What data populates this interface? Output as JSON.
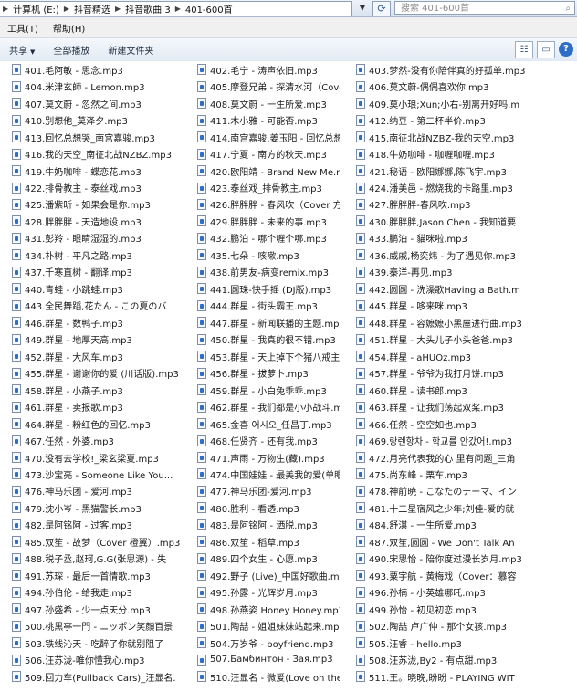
{
  "addressbar": {
    "crumbs": [
      "计算机 (E:)",
      "抖音精选",
      "抖音歌曲 3",
      "401-600首"
    ],
    "search_placeholder": "搜索 401-600首"
  },
  "menubar": {
    "items": [
      "工具(T)",
      "帮助(H)"
    ]
  },
  "commandbar": {
    "share_label": "共享",
    "play_all_label": "全部播放",
    "new_folder_label": "新建文件夹"
  },
  "files": [
    "401.毛阿敏 - 思念.mp3",
    "402.毛宁 - 涛声依旧.mp3",
    "403.梦然-没有你陪伴真的好孤单.mp3",
    "404.米津玄師 - Lemon.mp3",
    "405.摩登兄弟 - 探清水河（Cover：",
    "406.莫文蔚-偶偶喜欢你.mp3",
    "407.莫文蔚 - 忽然之间.mp3",
    "408.莫文蔚 - 一生所爱.mp3",
    "409.莫小琅;Xun;小右-别离开好吗.m",
    "410.别想他_莫泽夕.mp3",
    "411.木小雅 - 可能否.mp3",
    "412.纳豆 - 第二杯半价.mp3",
    "413.回忆总想哭_南宫嘉骏.mp3",
    "414.南宫嘉骏,姜玉阳 - 回忆总想哭",
    "415.南征北战NZBZ-我的天空.mp3",
    "416.我的天空_南征北战NZBZ.mp3",
    "417.宁夏 - 南方的秋天.mp3",
    "418.牛奶咖啡 - 咖喱咖喱.mp3",
    "419.牛奶咖啡 - 蝶恋花.mp3",
    "420.欧阳靖 - Brand New Me.mp3",
    "421.秘语 - 欧阳娜娜,陈飞宇.mp3",
    "422.排骨教主 - 泰丝戏.mp3",
    "423.泰丝戏_排骨教主.mp3",
    "424.潘美邑 - 燃烧我的卡路里.mp3",
    "425.潘紫昕 - 如果会是你.mp3",
    "426.胖胖胖 - 春风吹（Cover 方大",
    "427.胖胖胖-春风吹.mp3",
    "428.胖胖胖 - 天造地设.mp3",
    "429.胖胖胖 - 未来的事.mp3",
    "430.胖胖胖,Jason Chen - 我知道要",
    "431.彭羚 - 眼睛湿湿的.mp3",
    "432.鹏泊 - 哪个喱个哪.mp3",
    "433.鹏泊 - 貓咪啦.mp3",
    "434.朴树 - 平凡之路.mp3",
    "435.七朵 - 咳嗽.mp3",
    "436.威戚,杨奕炜 - 为了遇见你.mp3",
    "437.千寒直树 - 翻译.mp3",
    "438.前男友-病变remix.mp3",
    "439.秦洋-再见.mp3",
    "440.青蛙 - 小跳蛙.mp3",
    "441.圆珠-快手摇 (DJ版).mp3",
    "442.圆圆 - 洗澡歌Having a Bath.m",
    "443.全民舞蹈,花たん - この夏のバ",
    "444.群星 - 街头霸王.mp3",
    "445.群星 - 哆来咪.mp3",
    "446.群星 - 数鸭子.mp3",
    "447.群星 - 新闻联播的主题.mp3",
    "448.群星 - 容嬷嬷小黑屋进行曲.mp3",
    "449.群星 - 地厚天高.mp3",
    "450.群星 - 我真的很不错.mp3",
    "451.群星 - 大头儿子小头爸爸.mp3",
    "452.群星 - 大风车.mp3",
    "453.群星 - 天上掉下个猪八戒主题曲",
    "454.群星 - aHUOz.mp3",
    "455.群星 - 谢谢你的爱 (川话版).mp3",
    "456.群星 - 拔萝卜.mp3",
    "457.群星 - 爷爷为我打月饼.mp3",
    "458.群星 - 小燕子.mp3",
    "459.群星 - 小白兔乖乖.mp3",
    "460.群星 - 读书郎.mp3",
    "461.群星 - 卖报歌.mp3",
    "462.群星 - 我们都是小小战斗.mp3",
    "463.群星 - 让我们荡起双桨.mp3",
    "464.群星 - 粉红色的回忆.mp3",
    "465.金喜 어시오_任昌丁.mp3",
    "466.任然 - 空空如也.mp3",
    "467.任然 - 外婆.mp3",
    "468.任贤齐 - 还有我.mp3",
    "469.랑렌항차 - 학교를 안갔어!.mp3",
    "470.没有去学校!_梁玄梁夏.mp3",
    "471.声雨 - 万物生(藏).mp3",
    "472.月亮代表我的心 里有问题_三角",
    "473.沙宝亮 - Someone Like You...",
    "474.中国娃娃 - 最美我的爱(单眼皮",
    "475.尚东峰 - 栗车.mp3",
    "476.神马乐团 - 爱河.mp3",
    "477.神马乐团-爱河.mp3",
    "478.神前暁 - こなたのテーマ、イン",
    "479.沈小岑 - 黑猫警长.mp3",
    "480.胜利 - 看透.mp3",
    "481.十二星宿风之少年;刘佳-爱的就",
    "482.是阿铭阿 - 过客.mp3",
    "483.是阿铭阿 - 洒脱.mp3",
    "484.舒淇 - 一生所爱.mp3",
    "485.双笙 - 故梦（Cover 橙翼）.mp3",
    "486.双笙 - 稻草.mp3",
    "487.双笙,圆圆 - We Don't Talk An",
    "488.税子丞,赵珂,G.G(张思源) - 失",
    "489.四个女生 - 心愿.mp3",
    "490.宋思怡 - 陪你度过漫长岁月.mp3",
    "491.苏琛 - 最后一首情歌.mp3",
    "492.野子 (Live)_中国好歌曲.mp3",
    "493.粟宇航 - 黄梅戏（Cover：慕容",
    "494.孙伯伦 - 给我走.mp3",
    "495.孙露 - 光辉岁月.mp3",
    "496.孙楠 - 小英雄哪吒.mp3",
    "497.孙盛希 - 少一点天分.mp3",
    "498.孙燕姿 Honey Honey.mp3",
    "499.孙怡 - 初见初恋.mp3",
    "500.桃黒亭一門 - ニッポン笑顔百景",
    "501.陶喆 - 姐姐妹妹站起来.mp3",
    "502.陶喆 卢广仲 - 那个女孩.mp3",
    "503.铁线沁天 - 吃醉了你就别阻了",
    "504.万岁爷 - boyfriend.mp3",
    "505.汪睿 - hello.mp3",
    "506.汪苏泷-唯你懂我心.mp3",
    "507.Бамбинтон - Зая.mp3",
    "508.汪苏泷,By2 - 有点甜.mp3",
    "509.回力车(Pullback Cars)_汪显名.",
    "510.汪显名 - 微爱(Love on the Clo",
    "511.王。晓晚,盼盼 - PLAYING WIT"
  ]
}
